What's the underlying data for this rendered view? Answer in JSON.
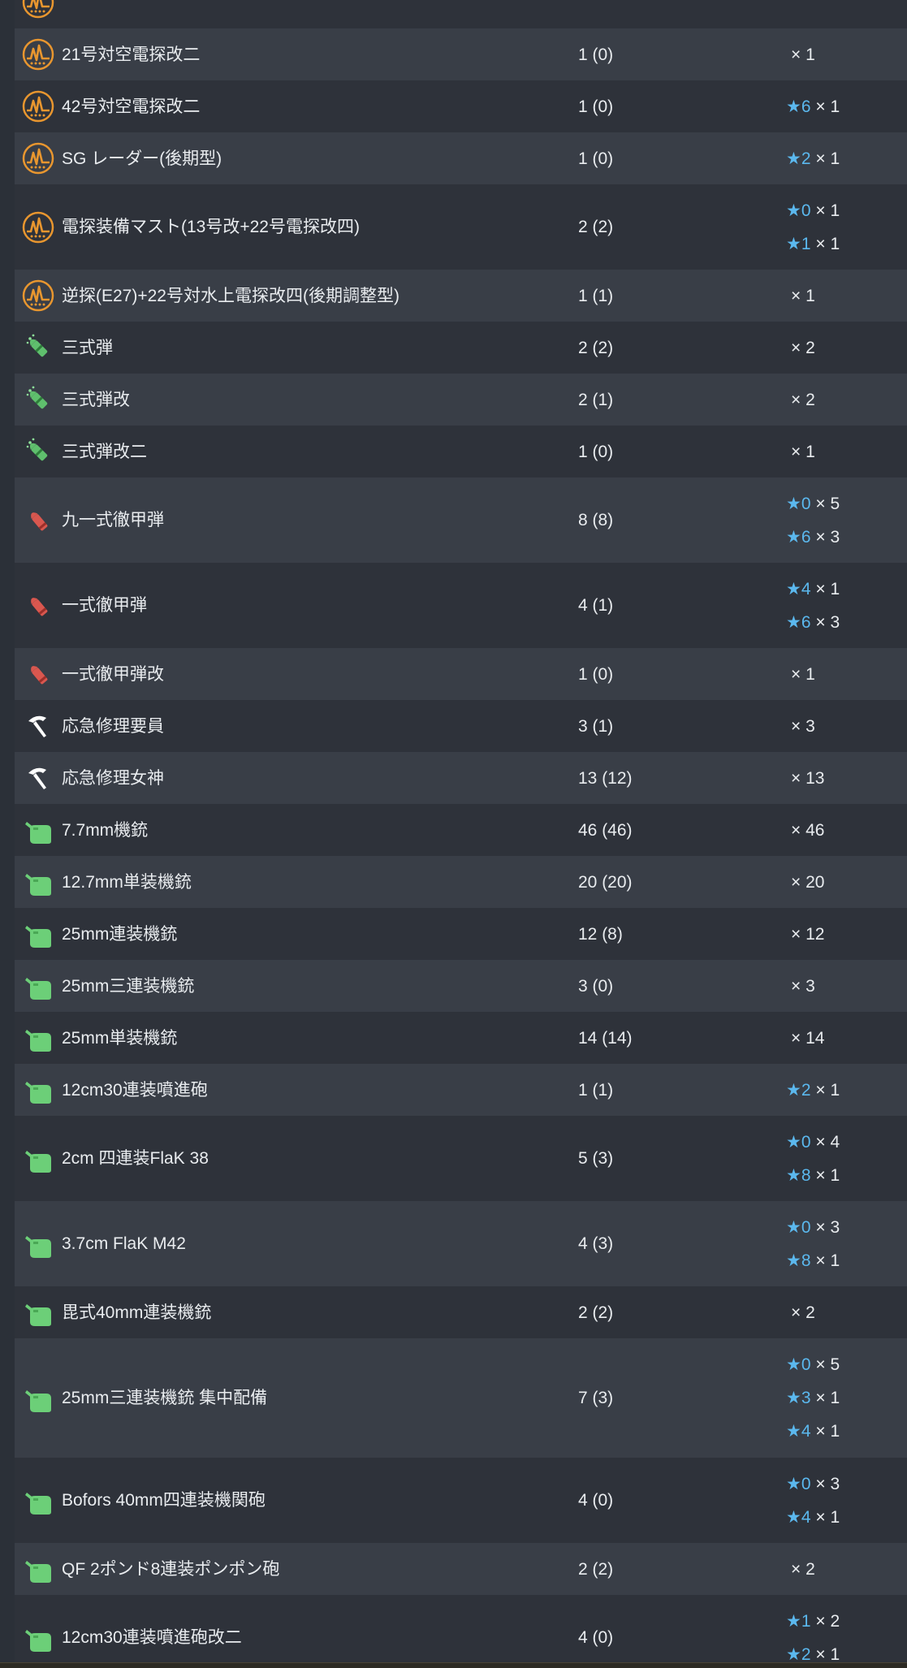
{
  "colors": {
    "row_even": "#2e323a",
    "row_odd": "#393e47",
    "star": "#5bb8ee",
    "radar_icon": "#e8962f",
    "shell3_icon": "#5fbf6d",
    "ap_icon": "#d9574f",
    "repair_icon": "#ffffff",
    "aa_icon": "#6ccf78"
  },
  "rows": [
    {
      "icon": "radar-icon",
      "name": "",
      "count": "",
      "improve": []
    },
    {
      "icon": "radar-icon",
      "name": "21号対空電探改二",
      "count": "1 (0)",
      "improve": [
        {
          "star": "",
          "mult": "× 1"
        }
      ]
    },
    {
      "icon": "radar-icon",
      "name": "42号対空電探改二",
      "count": "1 (0)",
      "improve": [
        {
          "star": "★6",
          "mult": "× 1"
        }
      ]
    },
    {
      "icon": "radar-icon",
      "name": "SG レーダー(後期型)",
      "count": "1 (0)",
      "improve": [
        {
          "star": "★2",
          "mult": "× 1"
        }
      ]
    },
    {
      "icon": "radar-icon",
      "name": "電探装備マスト(13号改+22号電探改四)",
      "count": "2 (2)",
      "improve": [
        {
          "star": "★0",
          "mult": "× 1"
        },
        {
          "star": "★1",
          "mult": "× 1"
        }
      ]
    },
    {
      "icon": "radar-icon",
      "name": "逆探(E27)+22号対水上電探改四(後期調整型)",
      "count": "1 (1)",
      "improve": [
        {
          "star": "",
          "mult": "× 1"
        }
      ]
    },
    {
      "icon": "type3-shell-icon",
      "name": "三式弾",
      "count": "2 (2)",
      "improve": [
        {
          "star": "",
          "mult": "× 2"
        }
      ]
    },
    {
      "icon": "type3-shell-icon",
      "name": "三式弾改",
      "count": "2 (1)",
      "improve": [
        {
          "star": "",
          "mult": "× 2"
        }
      ]
    },
    {
      "icon": "type3-shell-icon",
      "name": "三式弾改二",
      "count": "1 (0)",
      "improve": [
        {
          "star": "",
          "mult": "× 1"
        }
      ]
    },
    {
      "icon": "ap-shell-icon",
      "name": "九一式徹甲弾",
      "count": "8 (8)",
      "improve": [
        {
          "star": "★0",
          "mult": "× 5"
        },
        {
          "star": "★6",
          "mult": "× 3"
        }
      ]
    },
    {
      "icon": "ap-shell-icon",
      "name": "一式徹甲弾",
      "count": "4 (1)",
      "improve": [
        {
          "star": "★4",
          "mult": "× 1"
        },
        {
          "star": "★6",
          "mult": "× 3"
        }
      ]
    },
    {
      "icon": "ap-shell-icon",
      "name": "一式徹甲弾改",
      "count": "1 (0)",
      "improve": [
        {
          "star": "",
          "mult": "× 1"
        }
      ]
    },
    {
      "icon": "repair-icon",
      "name": "応急修理要員",
      "count": "3 (1)",
      "improve": [
        {
          "star": "",
          "mult": "× 3"
        }
      ]
    },
    {
      "icon": "repair-icon",
      "name": "応急修理女神",
      "count": "13 (12)",
      "improve": [
        {
          "star": "",
          "mult": "× 13"
        }
      ]
    },
    {
      "icon": "aa-gun-icon",
      "name": "7.7mm機銃",
      "count": "46 (46)",
      "improve": [
        {
          "star": "",
          "mult": "× 46"
        }
      ]
    },
    {
      "icon": "aa-gun-icon",
      "name": "12.7mm単装機銃",
      "count": "20 (20)",
      "improve": [
        {
          "star": "",
          "mult": "× 20"
        }
      ]
    },
    {
      "icon": "aa-gun-icon",
      "name": "25mm連装機銃",
      "count": "12 (8)",
      "improve": [
        {
          "star": "",
          "mult": "× 12"
        }
      ]
    },
    {
      "icon": "aa-gun-icon",
      "name": "25mm三連装機銃",
      "count": "3 (0)",
      "improve": [
        {
          "star": "",
          "mult": "× 3"
        }
      ]
    },
    {
      "icon": "aa-gun-icon",
      "name": "25mm単装機銃",
      "count": "14 (14)",
      "improve": [
        {
          "star": "",
          "mult": "× 14"
        }
      ]
    },
    {
      "icon": "aa-gun-icon",
      "name": "12cm30連装噴進砲",
      "count": "1 (1)",
      "improve": [
        {
          "star": "★2",
          "mult": "× 1"
        }
      ]
    },
    {
      "icon": "aa-gun-icon",
      "name": "2cm 四連装FlaK 38",
      "count": "5 (3)",
      "improve": [
        {
          "star": "★0",
          "mult": "× 4"
        },
        {
          "star": "★8",
          "mult": "× 1"
        }
      ]
    },
    {
      "icon": "aa-gun-icon",
      "name": "3.7cm FlaK M42",
      "count": "4 (3)",
      "improve": [
        {
          "star": "★0",
          "mult": "× 3"
        },
        {
          "star": "★8",
          "mult": "× 1"
        }
      ]
    },
    {
      "icon": "aa-gun-icon",
      "name": "毘式40mm連装機銃",
      "count": "2 (2)",
      "improve": [
        {
          "star": "",
          "mult": "× 2"
        }
      ]
    },
    {
      "icon": "aa-gun-icon",
      "name": "25mm三連装機銃 集中配備",
      "count": "7 (3)",
      "improve": [
        {
          "star": "★0",
          "mult": "× 5"
        },
        {
          "star": "★3",
          "mult": "× 1"
        },
        {
          "star": "★4",
          "mult": "× 1"
        }
      ]
    },
    {
      "icon": "aa-gun-icon",
      "name": "Bofors 40mm四連装機関砲",
      "count": "4 (0)",
      "improve": [
        {
          "star": "★0",
          "mult": "× 3"
        },
        {
          "star": "★4",
          "mult": "× 1"
        }
      ]
    },
    {
      "icon": "aa-gun-icon",
      "name": "QF 2ポンド8連装ポンポン砲",
      "count": "2 (2)",
      "improve": [
        {
          "star": "",
          "mult": "× 2"
        }
      ]
    },
    {
      "icon": "aa-gun-icon",
      "name": "12cm30連装噴進砲改二",
      "count": "4 (0)",
      "improve": [
        {
          "star": "★1",
          "mult": "× 2"
        },
        {
          "star": "★2",
          "mult": "× 1"
        }
      ]
    }
  ]
}
